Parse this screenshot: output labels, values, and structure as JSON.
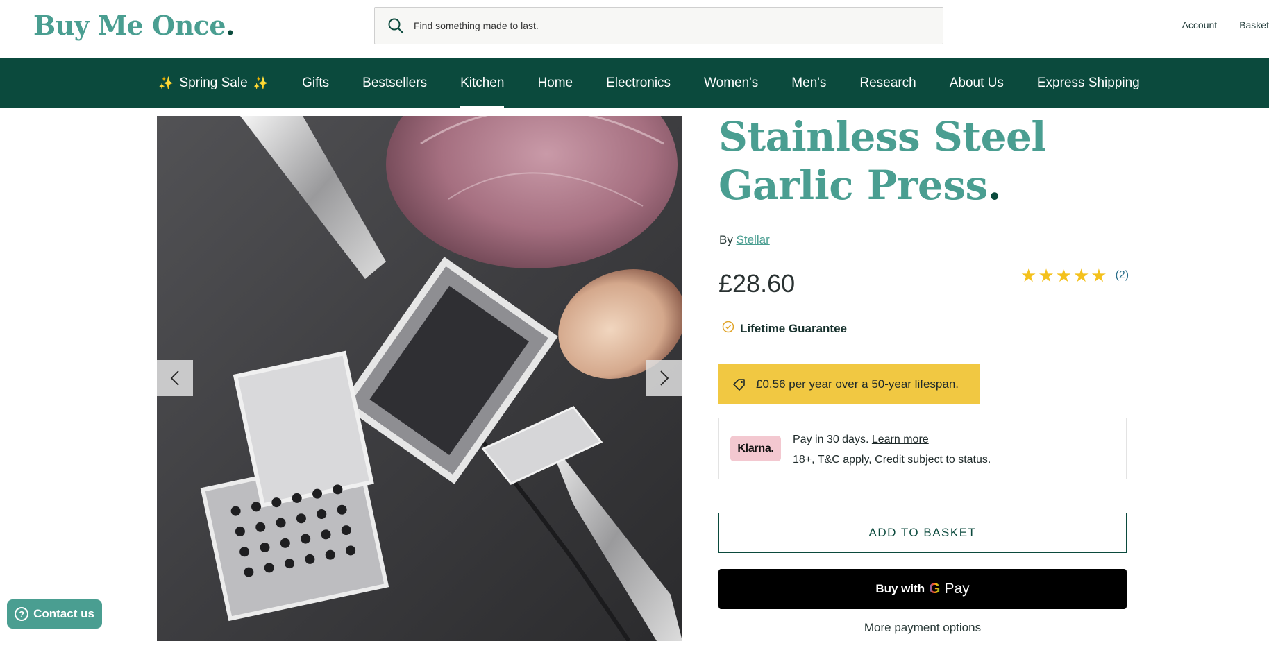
{
  "header": {
    "logo_text": "Buy Me Once",
    "logo_dot": ".",
    "search_placeholder": "Find something made to last.",
    "account_label": "Account",
    "basket_label": "Basket"
  },
  "nav": {
    "items": [
      {
        "label": "Spring Sale",
        "spark": "✨"
      },
      {
        "label": "Gifts"
      },
      {
        "label": "Bestsellers"
      },
      {
        "label": "Kitchen",
        "active": true
      },
      {
        "label": "Home"
      },
      {
        "label": "Electronics"
      },
      {
        "label": "Women's"
      },
      {
        "label": "Men's"
      },
      {
        "label": "Research"
      },
      {
        "label": "About Us"
      },
      {
        "label": "Express Shipping"
      }
    ]
  },
  "gallery": {
    "prev_icon": "chevron-left-icon",
    "next_icon": "chevron-right-icon"
  },
  "product": {
    "title": "Stainless Steel Garlic Press",
    "title_dot": ".",
    "by_prefix": "By",
    "brand": "Stellar",
    "price": "£28.60",
    "rating": 5,
    "rating_max": 5,
    "rating_count": "(2)",
    "guarantee": "Lifetime Guarantee",
    "lifespan_text": "£0.56 per year over a 50-year lifespan."
  },
  "klarna": {
    "badge": "Klarna.",
    "line1": "Pay in 30 days.",
    "learn_more": "Learn more",
    "line2": "18+, T&C apply, Credit subject to status."
  },
  "buttons": {
    "add_to_basket": "ADD TO BASKET",
    "buy_with": "Buy with",
    "gpay_g": "G",
    "gpay_pay": "Pay",
    "more_payment": "More payment options"
  },
  "contact": {
    "label": "Contact us",
    "icon_glyph": "?"
  },
  "colors": {
    "brand_teal": "#4a9e91",
    "nav_green": "#0b4a3d",
    "lifespan_yellow": "#f1c842",
    "star_yellow": "#f4c11d",
    "klarna_pink": "#f3c8d0"
  }
}
